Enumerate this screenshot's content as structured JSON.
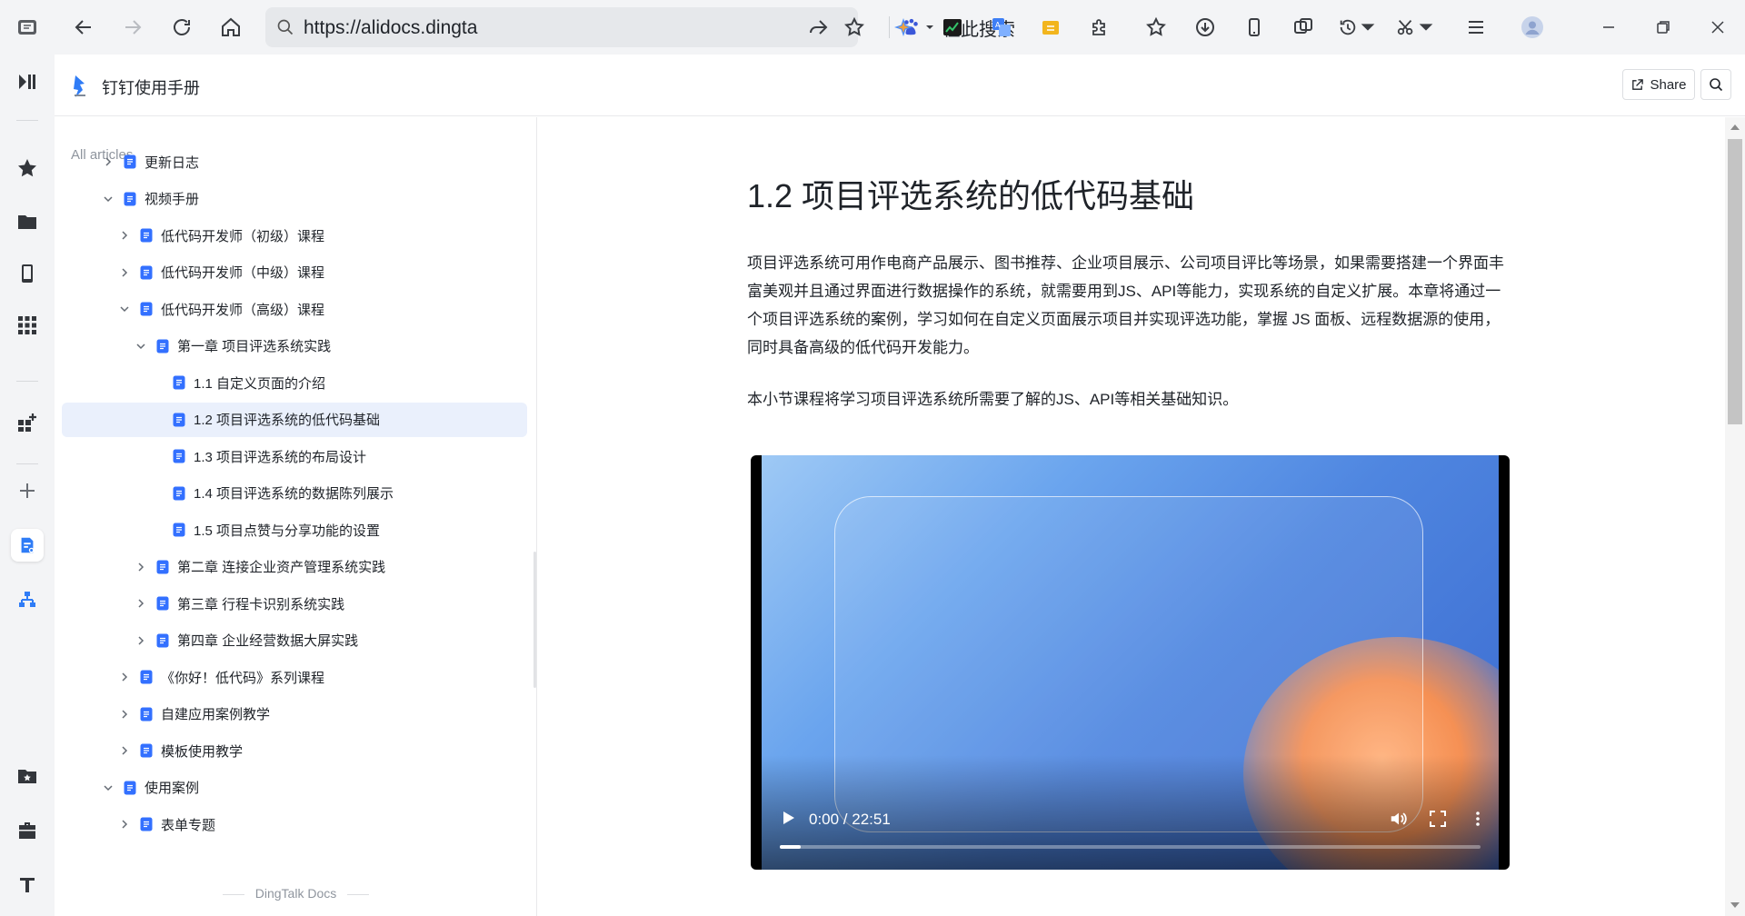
{
  "browser": {
    "url": "https://alidocs.dingta",
    "search_placeholder": "在此搜索"
  },
  "header": {
    "title": "钉钉使用手册",
    "share_label": "Share"
  },
  "sidebar": {
    "heading": "All articles",
    "footer": "DingTalk Docs",
    "items": [
      {
        "label": "更新日志",
        "level": 0,
        "state": "collapsed"
      },
      {
        "label": "视频手册",
        "level": 0,
        "state": "expanded"
      },
      {
        "label": "低代码开发师（初级）课程",
        "level": 1,
        "state": "collapsed"
      },
      {
        "label": "低代码开发师（中级）课程",
        "level": 1,
        "state": "collapsed"
      },
      {
        "label": "低代码开发师（高级）课程",
        "level": 1,
        "state": "expanded"
      },
      {
        "label": "第一章 项目评选系统实践",
        "level": 2,
        "state": "expanded"
      },
      {
        "label": "1.1 自定义页面的介绍",
        "level": 3,
        "state": "leaf"
      },
      {
        "label": "1.2 项目评选系统的低代码基础",
        "level": 3,
        "state": "leaf",
        "selected": true
      },
      {
        "label": "1.3 项目评选系统的布局设计",
        "level": 3,
        "state": "leaf"
      },
      {
        "label": "1.4 项目评选系统的数据陈列展示",
        "level": 3,
        "state": "leaf"
      },
      {
        "label": "1.5 项目点赞与分享功能的设置",
        "level": 3,
        "state": "leaf"
      },
      {
        "label": "第二章 连接企业资产管理系统实践",
        "level": 2,
        "state": "collapsed"
      },
      {
        "label": "第三章 行程卡识别系统实践",
        "level": 2,
        "state": "collapsed"
      },
      {
        "label": "第四章 企业经营数据大屏实践",
        "level": 2,
        "state": "collapsed"
      },
      {
        "label": "《你好！低代码》系列课程",
        "level": 1,
        "state": "collapsed"
      },
      {
        "label": "自建应用案例教学",
        "level": 1,
        "state": "collapsed"
      },
      {
        "label": "模板使用教学",
        "level": 1,
        "state": "collapsed"
      },
      {
        "label": "使用案例",
        "level": 0,
        "state": "expanded"
      },
      {
        "label": "表单专题",
        "level": 1,
        "state": "collapsed"
      }
    ]
  },
  "article": {
    "title": "1.2 项目评选系统的低代码基础",
    "paragraph1": "项目评选系统可用作电商产品展示、图书推荐、企业项目展示、公司项目评比等场景，如果需要搭建一个界面丰富美观并且通过界面进行数据操作的系统，就需要用到JS、API等能力，实现系统的自定义扩展。本章将通过一个项目评选系统的案例，学习如何在自定义页面展示项目并实现评选功能，掌握 JS 面板、远程数据源的使用，同时具备高级的低代码开发能力。",
    "paragraph2": "本小节课程将学习项目评选系统所需要了解的JS、API等相关基础知识。"
  },
  "video": {
    "time": "0:00 / 22:51",
    "progress": 0.03
  },
  "colors": {
    "accent": "#3370ff",
    "selected_bg": "#eaf0fc"
  }
}
